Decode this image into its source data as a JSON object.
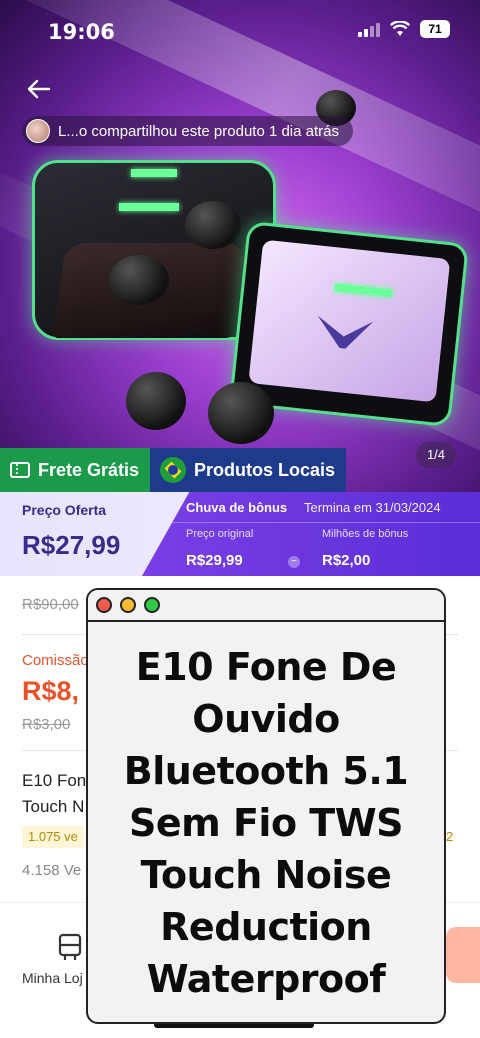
{
  "status_bar": {
    "time": "19:06",
    "battery": "71"
  },
  "share": {
    "text": "L...o compartilhou este produto 1 dia atrás"
  },
  "gallery": {
    "counter": "1/4"
  },
  "badges": {
    "shipping": "Frete Grátis",
    "local": "Produtos Locais"
  },
  "price": {
    "offer_label": "Preço Oferta",
    "offer_value": "R$27,99",
    "bonus_title": "Chuva de bônus",
    "bonus_ends": "Termina em 31/03/2024",
    "original_label": "Preço original",
    "original_value": "R$29,99",
    "bonus_label": "Milhões de bônus",
    "bonus_value": "R$2,00",
    "minus_sign": "−"
  },
  "details": {
    "old_price": "R$90,00",
    "commission_label": "Comissão",
    "commission_value": "R$8,",
    "old_commission": "R$3,00",
    "title_partial": "E10 Fon\nTouch N",
    "sales_partial": "1.075 ve",
    "sales_right_partial": "2",
    "sold_partial": "4.158 Ve"
  },
  "nav": {
    "store_label": "Minha Loj"
  },
  "overlay": {
    "title": "E10 Fone De Ouvido Bluetooth 5.1 Sem Fio TWS Touch Noise Reduction Waterproof"
  },
  "colors": {
    "accent_purple": "#5b2dd6",
    "commission_orange": "#e8542a",
    "shipping_green": "#1b9a4a",
    "local_blue": "#1e3a8a"
  }
}
